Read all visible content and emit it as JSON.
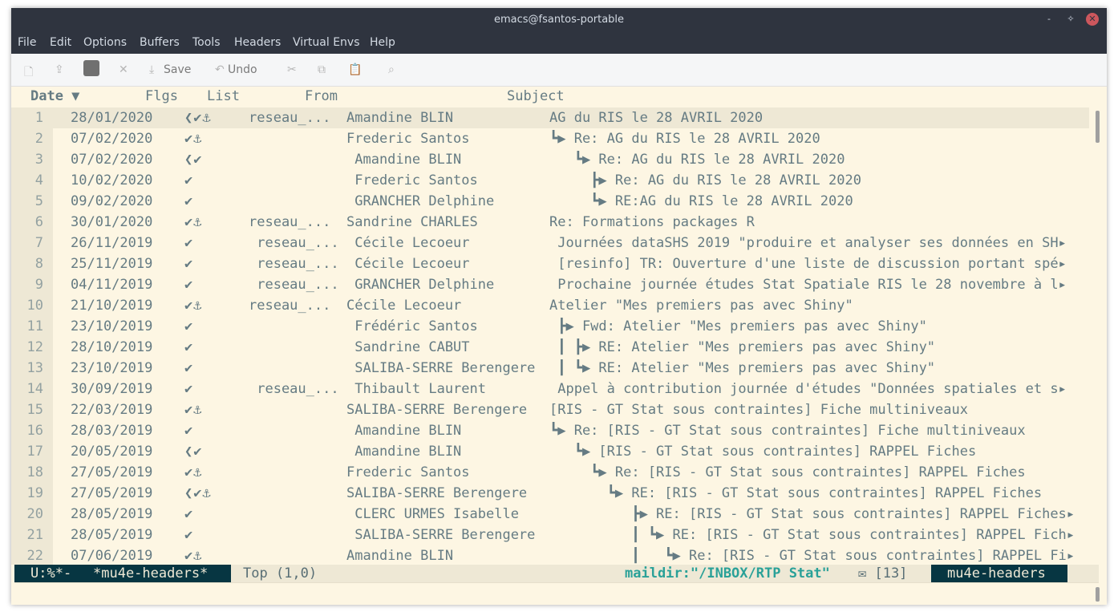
{
  "window": {
    "title": "emacs@fsantos-portable",
    "minimize": "‐",
    "maximize": "✧",
    "close": "✕"
  },
  "menu": [
    "File",
    "Edit",
    "Options",
    "Buffers",
    "Tools",
    "Headers",
    "Virtual Envs",
    "Help"
  ],
  "toolbar": {
    "save_label": "Save",
    "undo_label": "Undo"
  },
  "headers": {
    "date": "Date ▼",
    "flags": "Flgs",
    "list": "List",
    "from": "From",
    "subject": "Subject"
  },
  "rows": [
    {
      "n": "1",
      "date": "28/01/2020",
      "flags": "❮✔⚓",
      "list": "reseau_...",
      "from": "Amandine BLIN",
      "subject": "AG du RIS le 28 AVRIL 2020"
    },
    {
      "n": "2",
      "date": "07/02/2020",
      "flags": "✔⚓",
      "list": "",
      "from": "Frederic Santos",
      "subject": "┗▶ Re: AG du RIS le 28 AVRIL 2020"
    },
    {
      "n": "3",
      "date": "07/02/2020",
      "flags": "❮✔",
      "list": "",
      "from": " Amandine BLIN",
      "subject": "   ┗▶ Re: AG du RIS le 28 AVRIL 2020"
    },
    {
      "n": "4",
      "date": "10/02/2020",
      "flags": "✔",
      "list": "",
      "from": " Frederic Santos",
      "subject": "     ┣▶ Re: AG du RIS le 28 AVRIL 2020"
    },
    {
      "n": "5",
      "date": "09/02/2020",
      "flags": "✔",
      "list": "",
      "from": " GRANCHER Delphine",
      "subject": "     ┗▶ RE:AG du RIS le 28 AVRIL 2020"
    },
    {
      "n": "6",
      "date": "30/01/2020",
      "flags": "✔⚓",
      "list": "reseau_...",
      "from": "Sandrine CHARLES",
      "subject": "Re: Formations packages R"
    },
    {
      "n": "7",
      "date": "26/11/2019",
      "flags": "✔",
      "list": " reseau_...",
      "from": " Cécile Lecoeur",
      "subject": " Journées dataSHS 2019 \"produire et analyser ses données en SH▸"
    },
    {
      "n": "8",
      "date": "25/11/2019",
      "flags": "✔",
      "list": " reseau_...",
      "from": " Cécile Lecoeur",
      "subject": " [resinfo] TR: Ouverture d'une liste de discussion portant spé▸"
    },
    {
      "n": "9",
      "date": "04/11/2019",
      "flags": "✔",
      "list": " reseau_...",
      "from": " GRANCHER Delphine",
      "subject": " Prochaine journée études Stat Spatiale RIS le 28 novembre à l▸"
    },
    {
      "n": "10",
      "date": "21/10/2019",
      "flags": "✔⚓",
      "list": "reseau_...",
      "from": "Cécile Lecoeur",
      "subject": "Atelier \"Mes premiers pas avec Shiny\""
    },
    {
      "n": "11",
      "date": "23/10/2019",
      "flags": "✔",
      "list": "",
      "from": " Frédéric Santos",
      "subject": " ┣▶ Fwd: Atelier \"Mes premiers pas avec Shiny\""
    },
    {
      "n": "12",
      "date": "28/10/2019",
      "flags": "✔",
      "list": "",
      "from": " Sandrine CABUT",
      "subject": " ┃ ┣▶ RE: Atelier \"Mes premiers pas avec Shiny\""
    },
    {
      "n": "13",
      "date": "23/10/2019",
      "flags": "✔",
      "list": "",
      "from": " SALIBA-SERRE Berengere",
      "subject": " ┃ ┗▶ RE: Atelier \"Mes premiers pas avec Shiny\""
    },
    {
      "n": "14",
      "date": "30/09/2019",
      "flags": "✔",
      "list": " reseau_...",
      "from": " Thibault Laurent",
      "subject": " Appel à contribution journée d'études \"Données spatiales et s▸"
    },
    {
      "n": "15",
      "date": "22/03/2019",
      "flags": "✔⚓",
      "list": "",
      "from": "SALIBA-SERRE Berengere",
      "subject": "[RIS - GT Stat sous contraintes] Fiche multiniveaux"
    },
    {
      "n": "16",
      "date": "28/03/2019",
      "flags": "✔",
      "list": "",
      "from": " Amandine BLIN",
      "subject": "┗▶ Re: [RIS - GT Stat sous contraintes] Fiche multiniveaux"
    },
    {
      "n": "17",
      "date": "20/05/2019",
      "flags": "❮✔",
      "list": "",
      "from": " Amandine BLIN",
      "subject": "   ┗▶ [RIS - GT Stat sous contraintes] RAPPEL Fiches"
    },
    {
      "n": "18",
      "date": "27/05/2019",
      "flags": "✔⚓",
      "list": "",
      "from": "Frederic Santos",
      "subject": "     ┗▶ Re: [RIS - GT Stat sous contraintes] RAPPEL Fiches"
    },
    {
      "n": "19",
      "date": "27/05/2019",
      "flags": "❮✔⚓",
      "list": "",
      "from": "SALIBA-SERRE Berengere",
      "subject": "       ┗▶ RE: [RIS - GT Stat sous contraintes] RAPPEL Fiches"
    },
    {
      "n": "20",
      "date": "28/05/2019",
      "flags": "✔",
      "list": "",
      "from": " CLERC URMES Isabelle",
      "subject": "          ┣▶ RE: [RIS - GT Stat sous contraintes] RAPPEL Fiches▸"
    },
    {
      "n": "21",
      "date": "28/05/2019",
      "flags": "✔",
      "list": "",
      "from": " SALIBA-SERRE Berengere",
      "subject": "          ┃ ┗▶ RE: [RIS - GT Stat sous contraintes] RAPPEL Fich▸"
    },
    {
      "n": "22",
      "date": "07/06/2019",
      "flags": "✔⚓",
      "list": "",
      "from": "Amandine BLIN",
      "subject": "          ┃   ┗▶ Re: [RIS - GT Stat sous contraintes] RAPPEL Fi▸"
    }
  ],
  "modeline": {
    "state": "U:%*-",
    "buffer": "*mu4e-headers*",
    "position": "Top (1,0)",
    "maildir": "maildir:\"/INBOX/RTP Stat\"",
    "count": "✉ [13]",
    "mode": "mu4e-headers"
  }
}
